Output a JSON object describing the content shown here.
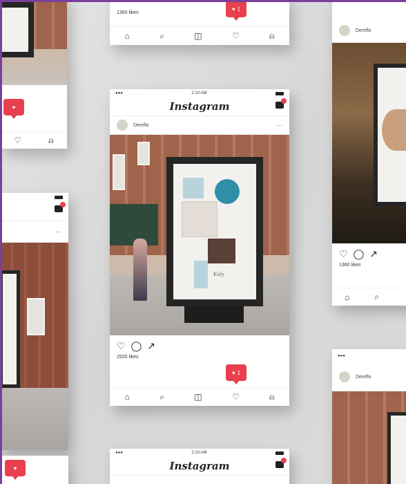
{
  "app": {
    "brand": "Instagram",
    "time": "2:10 AM",
    "username": "Dereflo"
  },
  "cards": {
    "top_center": {
      "likes": "1360 likes",
      "notif_count": "1"
    },
    "center": {
      "likes": "2520 likes",
      "notif_count": "1",
      "poster_brand": "Kuly"
    },
    "right_mid": {
      "likes": "1360 likes"
    },
    "bottom_center": {
      "time": "2:10 AM"
    },
    "bottom_right": {
      "username": "Dereflo"
    }
  },
  "colors": {
    "accent": "#e8404e",
    "frame": "#7a3f9a"
  },
  "icons": [
    "home-icon",
    "search-icon",
    "camera-icon",
    "heart-icon",
    "profile-icon",
    "comment-icon",
    "share-icon",
    "inbox-icon"
  ]
}
